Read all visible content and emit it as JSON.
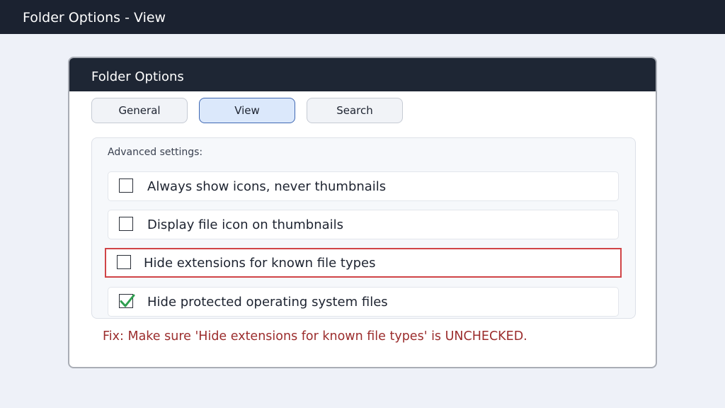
{
  "window": {
    "title": "Folder Options - View"
  },
  "dialog": {
    "title": "Folder Options",
    "tabs": [
      {
        "label": "General",
        "active": false
      },
      {
        "label": "View",
        "active": true
      },
      {
        "label": "Search",
        "active": false
      }
    ],
    "advanced_settings": {
      "label": "Advanced settings:",
      "options": [
        {
          "label": "Always show icons, never thumbnails",
          "checked": false,
          "highlighted": false
        },
        {
          "label": "Display file icon on thumbnails",
          "checked": false,
          "highlighted": false
        },
        {
          "label": "Hide extensions for known file types",
          "checked": false,
          "highlighted": true
        },
        {
          "label": "Hide protected operating system files",
          "checked": true,
          "highlighted": false
        }
      ]
    },
    "fix_note": "Fix: Make sure 'Hide extensions for known file types' is UNCHECKED."
  },
  "colors": {
    "highlight_border": "#d04447",
    "check_mark": "#2e9e4f",
    "fix_note_text": "#9b2c2c",
    "active_tab_border": "#3f68b3"
  },
  "icons": {
    "checked": "checkmark-icon"
  }
}
